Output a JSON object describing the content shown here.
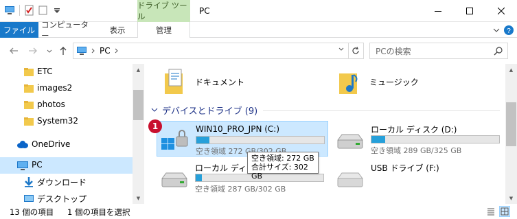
{
  "window": {
    "context_tab_header": "ドライブ ツール",
    "title": "PC"
  },
  "ribbon": {
    "tabs": [
      "ファイル",
      "コンピューター",
      "表示",
      "管理"
    ]
  },
  "address": {
    "crumbs": [
      "PC"
    ],
    "search_placeholder": "PCの検索"
  },
  "nav_pane": {
    "items": [
      {
        "label": "ETC",
        "icon": "folder-icon"
      },
      {
        "label": "images2",
        "icon": "folder-icon"
      },
      {
        "label": "photos",
        "icon": "folder-icon"
      },
      {
        "label": "System32",
        "icon": "folder-icon"
      },
      {
        "label": "OneDrive",
        "icon": "onedrive-icon"
      },
      {
        "label": "PC",
        "icon": "pc-icon",
        "selected": true
      },
      {
        "label": "ダウンロード",
        "icon": "download-icon"
      },
      {
        "label": "デスクトップ",
        "icon": "desktop-icon"
      }
    ]
  },
  "content": {
    "folders": [
      {
        "label": "ドキュメント",
        "icon": "documents-folder-icon"
      },
      {
        "label": "ミュージック",
        "icon": "music-folder-icon"
      }
    ],
    "group_header": "デバイスとドライブ (9)",
    "drives": [
      {
        "name": "WIN10_PRO_JPN (C:)",
        "free": "空き領域 272 GB/302 GB",
        "used_fraction": 0.1,
        "selected": true,
        "icon": "windows-drive-icon"
      },
      {
        "name": "ローカル ディスク (D:)",
        "free": "空き領域 289 GB/325 GB",
        "used_fraction": 0.11,
        "selected": false,
        "icon": "hard-drive-icon"
      },
      {
        "name": "ローカル ディスク",
        "free": "空き領域 287 GB/302 GB",
        "used_fraction": 0.05,
        "selected": false,
        "icon": "hard-drive-icon"
      },
      {
        "name": "USB ドライブ (F:)",
        "free": "",
        "used_fraction": null,
        "selected": false,
        "icon": "usb-drive-icon"
      }
    ],
    "tooltip": {
      "line1": "空き領域: 272 GB",
      "line2": "合計サイズ: 302 GB"
    },
    "badge": "1"
  },
  "status": {
    "item_count": "13 個の項目",
    "selection": "1 個の項目を選択"
  },
  "colors": {
    "accent": "#1979ca",
    "selection": "#cce8ff",
    "context_tab": "#c8e6b9",
    "drive_bar": "#26a0da",
    "badge": "#c8102e"
  }
}
